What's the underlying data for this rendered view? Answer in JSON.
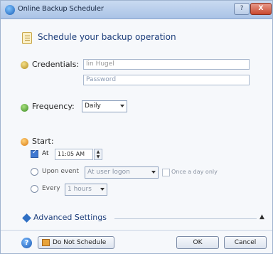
{
  "window": {
    "title": "Online Backup Scheduler",
    "help_button": "?",
    "close_button": "X"
  },
  "header": {
    "text": "Schedule your backup operation"
  },
  "credentials": {
    "label": "Credentials:",
    "username_value": "lin Hugel",
    "password_placeholder": "Password"
  },
  "frequency": {
    "label": "Frequency:",
    "selected": "Daily"
  },
  "start": {
    "label": "Start:",
    "at_label": "At",
    "time_value": "11:05 AM",
    "upon_event_label": "Upon event",
    "event_selected": "At user logon",
    "once_a_day_label": "Once a day only",
    "every_label": "Every",
    "every_selected": "1 hours"
  },
  "advanced": {
    "label": "Advanced Settings"
  },
  "footer": {
    "do_not_schedule": "Do Not Schedule",
    "ok": "OK",
    "cancel": "Cancel"
  },
  "colors": {
    "accent": "#2b5cab",
    "titlebar": "#aac3e6",
    "close": "#c9482f"
  }
}
